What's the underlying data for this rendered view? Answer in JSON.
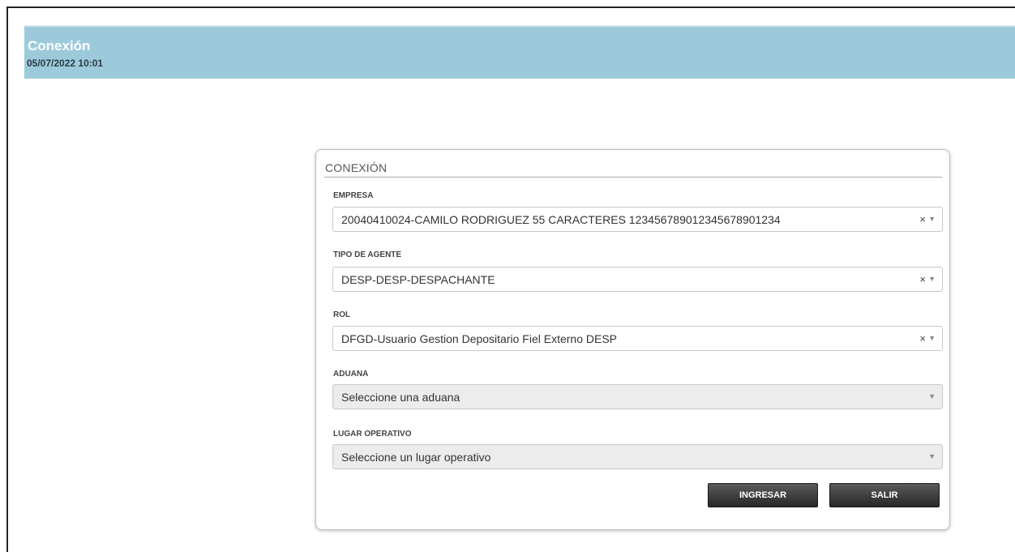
{
  "header": {
    "title": "Conexión",
    "datetime": "05/07/2022 10:01"
  },
  "panel": {
    "title": "CONEXIÓN",
    "fields": [
      {
        "label": "EMPRESA",
        "value": "20040410024-CAMILO RODRIGUEZ 55 CARACTERES 12345678901234567890123​4",
        "clear": "×",
        "arrow": "▼"
      },
      {
        "label": "TIPO DE AGENTE",
        "value": "DESP-DESP-DESPACHANTE",
        "clear": "×",
        "arrow": "▼"
      },
      {
        "label": "ROL",
        "value": "DFGD-Usuario Gestion Depositario Fiel Externo DESP",
        "clear": "×",
        "arrow": "▼"
      },
      {
        "label": "ADUANA",
        "placeholder": "Seleccione una aduana",
        "arrow": "▼"
      },
      {
        "label": "LUGAR OPERATIVO",
        "placeholder": "Seleccione un lugar operativo",
        "arrow": "▼"
      }
    ],
    "buttons": {
      "ingresar": "INGRESAR",
      "salir": "SALIR"
    }
  },
  "colors": {
    "header_bg": "#9ccadb",
    "button_bg": "#333333"
  }
}
